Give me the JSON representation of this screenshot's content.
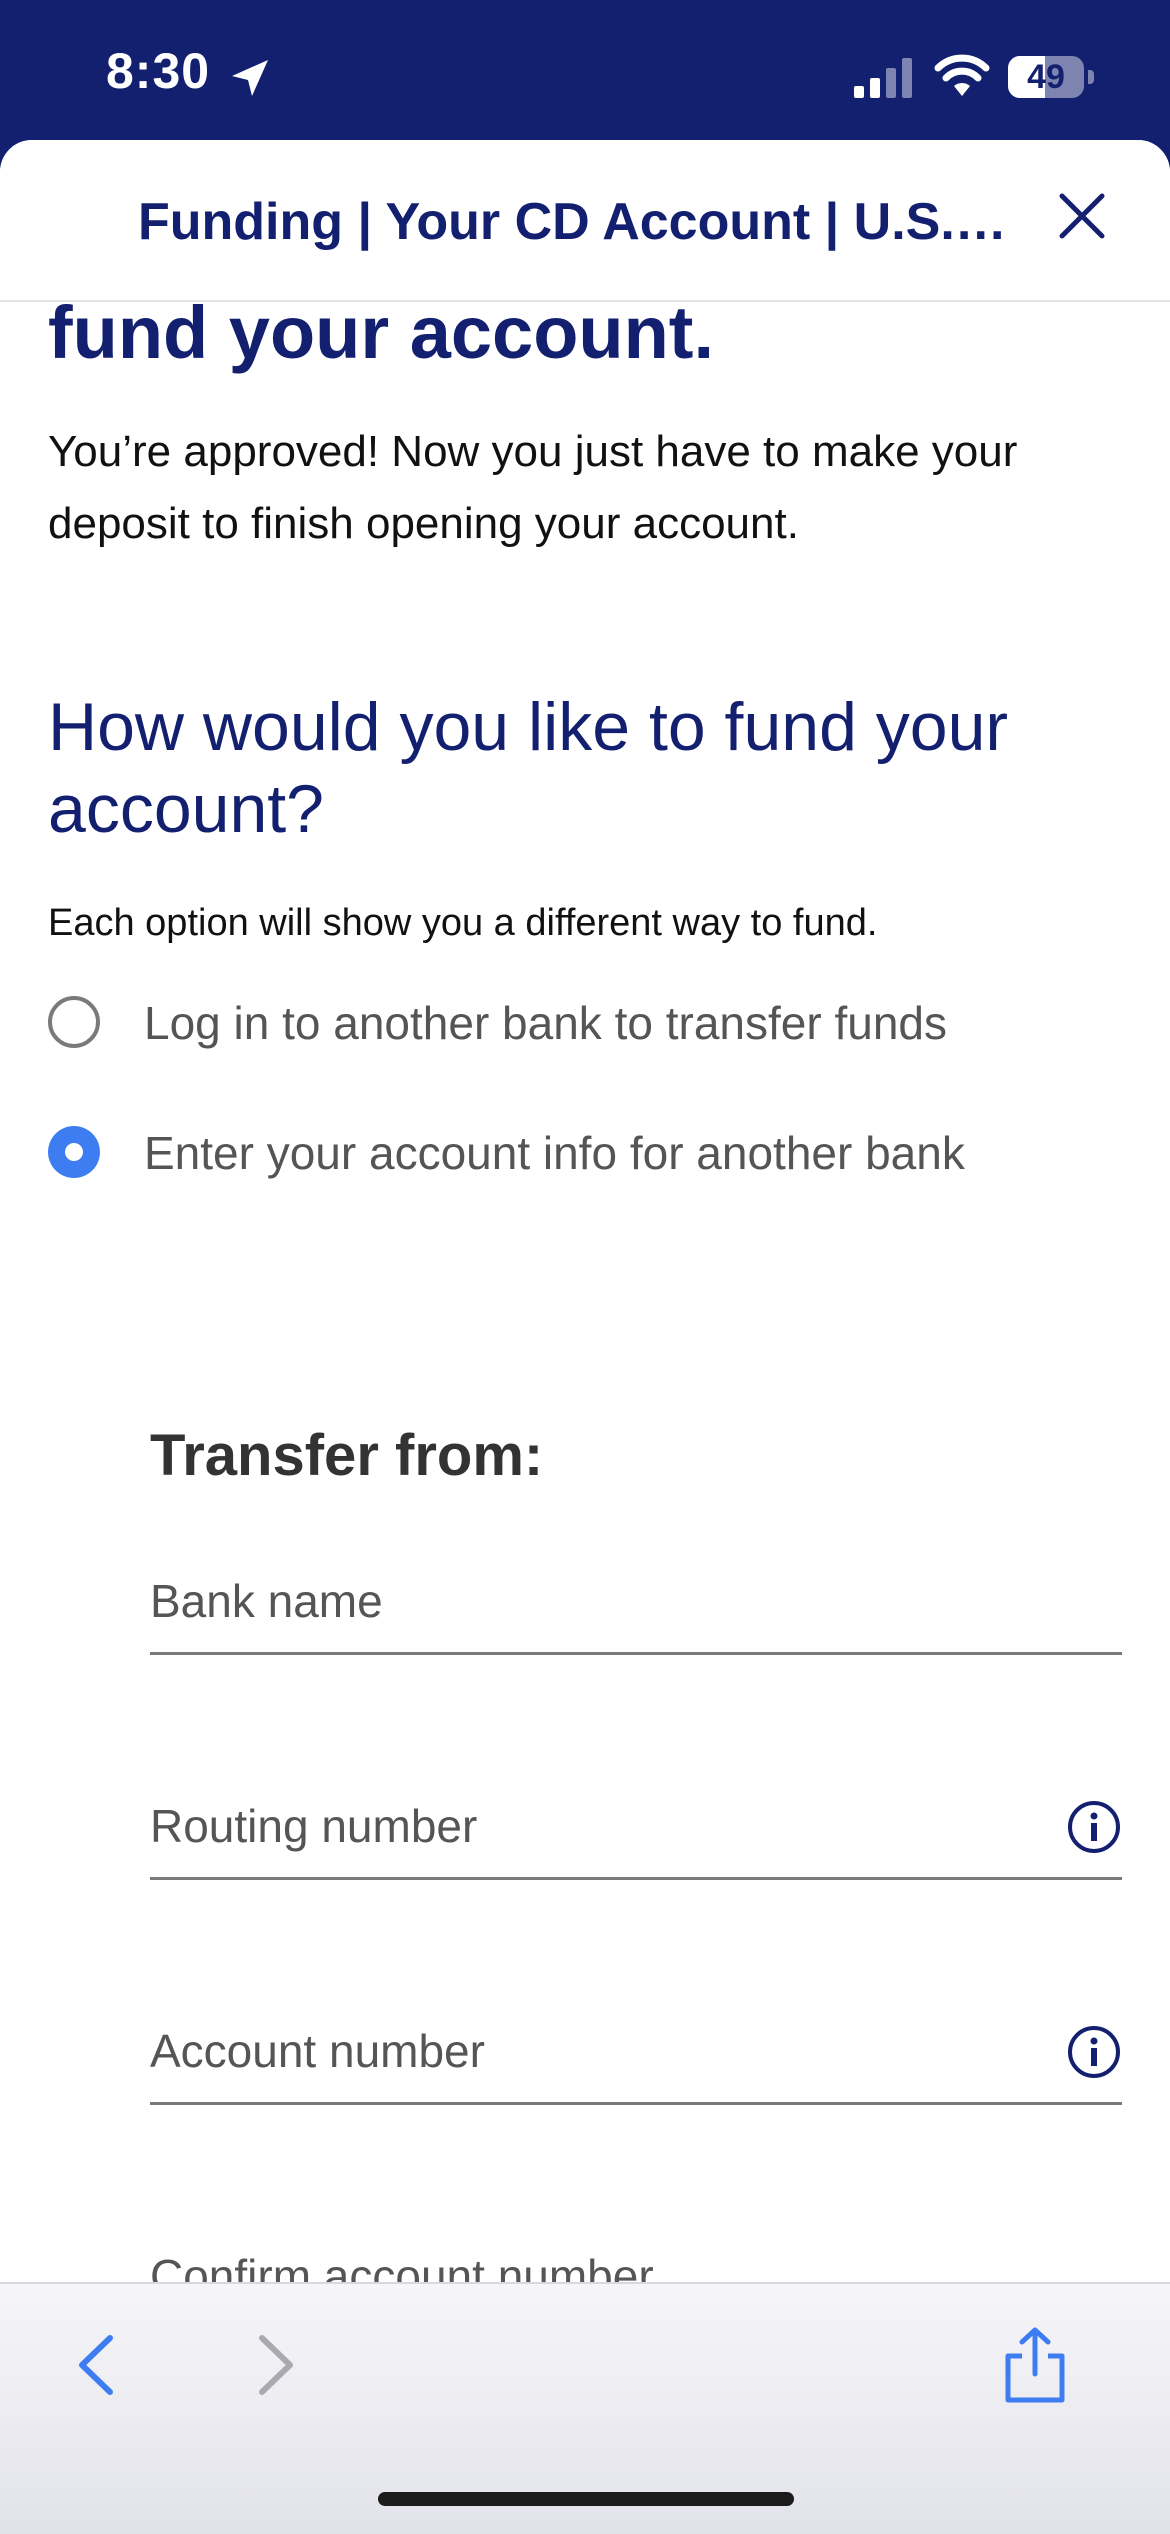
{
  "status_bar": {
    "time": "8:30",
    "battery": "49",
    "battery_level": 0.49,
    "icons": [
      "location-arrow-icon",
      "signal-icon",
      "wifi-icon",
      "battery-icon"
    ]
  },
  "sheet": {
    "title": "Funding | Your CD Account | U.S.…",
    "close_icon": "close-icon"
  },
  "content": {
    "heading_partial": "fund your account.",
    "intro": "You’re approved! Now you just have to make your deposit to finish opening your account.",
    "section_heading": "How would you like to fund your account?",
    "hint": "Each option will show you a different way to fund.",
    "options": [
      {
        "label": "Log in to another bank to transfer funds",
        "selected": false
      },
      {
        "label": "Enter your account info for another bank",
        "selected": true
      }
    ],
    "transfer_title": "Transfer from:",
    "fields": {
      "bank_name": {
        "placeholder": "Bank name",
        "value": ""
      },
      "routing_number": {
        "placeholder": "Routing number",
        "value": ""
      },
      "account_number": {
        "placeholder": "Account number",
        "value": ""
      },
      "confirm_account_number": {
        "placeholder": "Confirm account number",
        "value": ""
      }
    }
  },
  "toolbar": {
    "icons": [
      "chevron-left-icon",
      "chevron-right-icon",
      "share-icon"
    ]
  },
  "colors": {
    "brand": "#132070",
    "accent": "#3e7cf2"
  }
}
